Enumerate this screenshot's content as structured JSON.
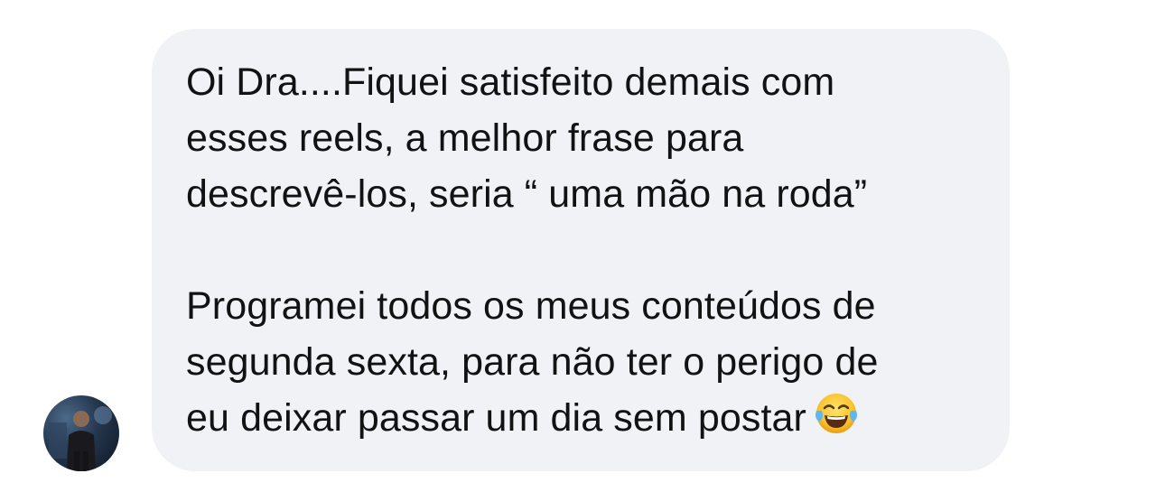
{
  "conversation": {
    "message": {
      "paragraph_1_lines": [
        "Oi Dra....Fiquei satisfeito demais com",
        "esses reels, a melhor frase para",
        "descrevê-los, seria “ uma mão na roda”"
      ],
      "paragraph_2_lines": [
        "Programei todos os meus conteúdos de",
        "segunda sexta, para não ter o perigo de",
        "eu deixar passar um dia sem postar"
      ],
      "trailing_emoji": "face-with-tears-of-joy-icon"
    },
    "colors": {
      "bubble_background": "#f1f2f6",
      "text": "#121212",
      "page_background": "#ffffff"
    }
  }
}
